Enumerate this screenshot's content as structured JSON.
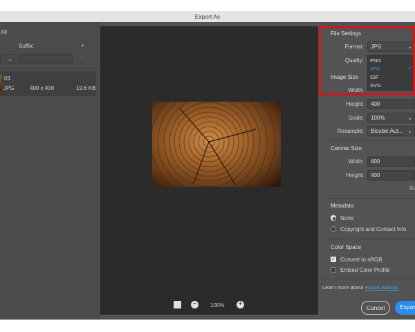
{
  "window": {
    "title": "Export As"
  },
  "left": {
    "all_label": "All",
    "suffix_label": "Suffix:",
    "add_symbol": "+",
    "remove_symbol": "−",
    "item": {
      "name": "01",
      "format": "JPG",
      "dimensions": "400 x 400",
      "size": "19.6 KB"
    }
  },
  "preview": {
    "zoom": "100%"
  },
  "file_settings": {
    "title": "File Settings",
    "format_label": "Format:",
    "format_value": "JPG",
    "quality_label": "Quality:",
    "options": [
      "PNG",
      "JPG",
      "GIF",
      "SVG"
    ],
    "selected_option": "JPG"
  },
  "image_size": {
    "title": "Image Size",
    "width_label": "Width:",
    "height_label": "Height:",
    "height_value": "400",
    "scale_label": "Scale:",
    "scale_value": "100%",
    "resample_label": "Resample:",
    "resample_value": "Bicubic Aut..."
  },
  "canvas_size": {
    "title": "Canvas Size",
    "width_label": "Width:",
    "width_value": "400",
    "height_label": "Height:",
    "height_value": "400",
    "reset_label": "Re"
  },
  "metadata": {
    "title": "Metadata",
    "none_label": "None",
    "copyright_label": "Copyright and Contact Info"
  },
  "color_space": {
    "title": "Color Space",
    "convert_label": "Convert to sRGB",
    "embed_label": "Embed Color Profile"
  },
  "footer": {
    "learn_more": "Learn more about",
    "export_options_link": "export options.",
    "cancel_label": "Cancel",
    "export_label": "Expor"
  },
  "colors": {
    "accent": "#2d9bf0",
    "highlight_box": "#d4151c"
  }
}
